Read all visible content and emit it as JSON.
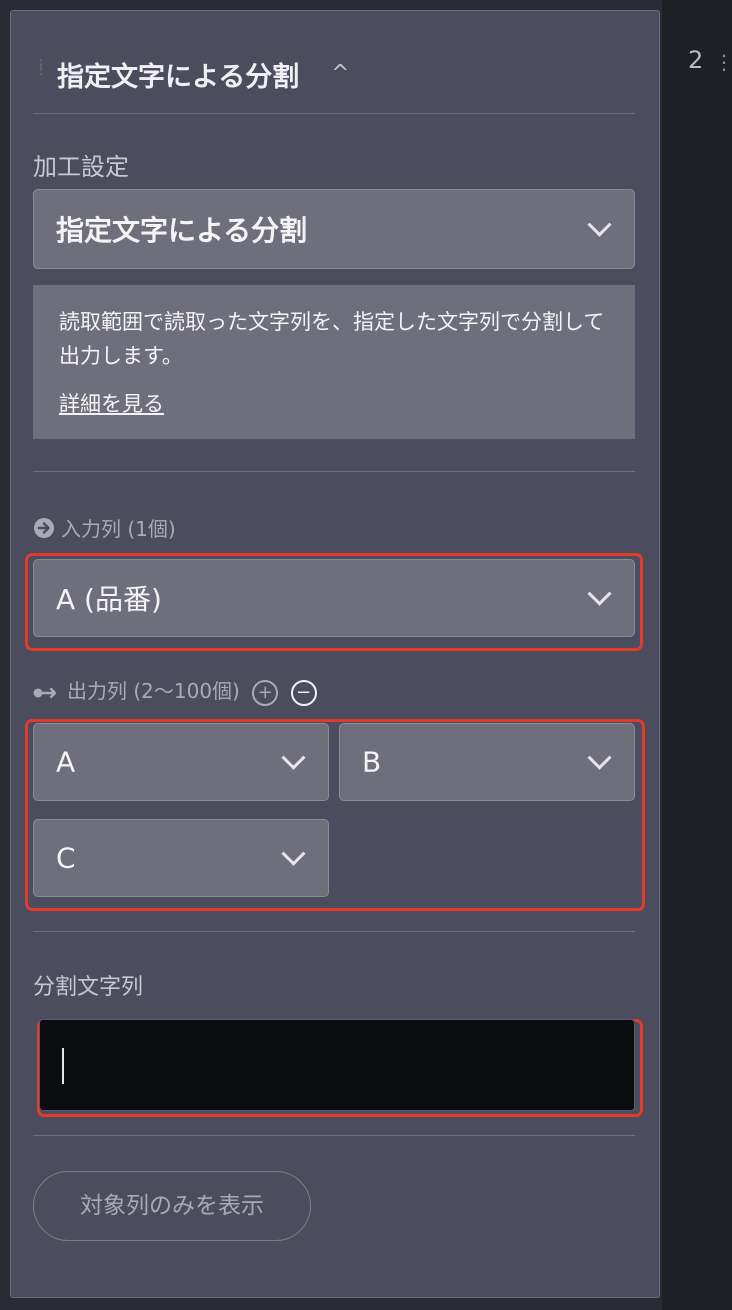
{
  "side": {
    "number": "2",
    "more": "⋮"
  },
  "header": {
    "title": "指定文字による分割",
    "caret": "^"
  },
  "processing": {
    "label": "加工設定",
    "selected": "指定文字による分割",
    "description": "読取範囲で読取った文字列を、指定した文字列で分割して出力します。",
    "detail_link": "詳細を見る"
  },
  "input_columns": {
    "label": "入力列 (1個)",
    "selected": "A (品番)"
  },
  "output_columns": {
    "label": "出力列 (2〜100個)",
    "add": "+",
    "remove": "−",
    "items": [
      "A",
      "B",
      "C"
    ]
  },
  "split_string": {
    "label": "分割文字列",
    "value": ""
  },
  "footer": {
    "button": "対象列のみを表示"
  },
  "colors": {
    "highlight": "#e23b2a",
    "panel": "#4b4c5d",
    "control": "#6f6f7c"
  },
  "icons": {
    "input": "arrow-right-circle-icon",
    "output": "arrow-output-icon"
  }
}
